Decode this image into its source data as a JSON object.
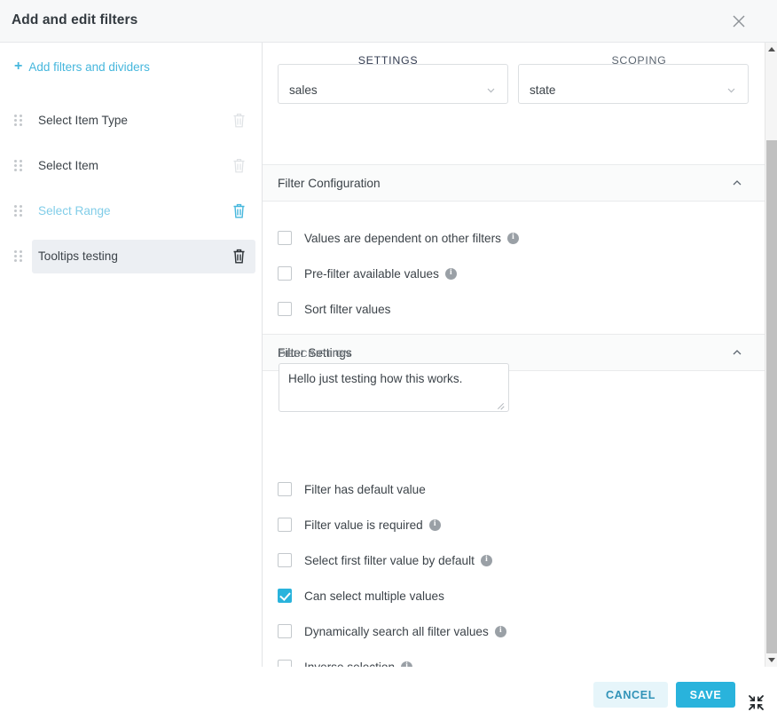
{
  "dialog": {
    "title": "Add and edit filters",
    "close_icon": "close-icon"
  },
  "sidebar": {
    "add_label": "Add filters and dividers",
    "add_icon": "plus-icon",
    "items": [
      {
        "label": "Select Item Type",
        "state": "normal"
      },
      {
        "label": "Select Item",
        "state": "normal"
      },
      {
        "label": "Select Range",
        "state": "teal"
      },
      {
        "label": "Tooltips testing",
        "state": "selected"
      }
    ]
  },
  "tabs": [
    {
      "label": "SETTINGS",
      "active": true
    },
    {
      "label": "SCOPING",
      "active": false
    }
  ],
  "selects": [
    {
      "value": "sales",
      "icon": "chevron-down-icon"
    },
    {
      "value": "state",
      "icon": "chevron-down-icon"
    }
  ],
  "sections": {
    "filter_configuration": {
      "title": "Filter Configuration",
      "collapse_icon": "chevron-up-icon",
      "options": [
        {
          "label": "Values are dependent on other filters",
          "checked": false,
          "info": true
        },
        {
          "label": "Pre-filter available values",
          "checked": false,
          "info": true
        },
        {
          "label": "Sort filter values",
          "checked": false,
          "info": false
        }
      ]
    },
    "filter_settings": {
      "title": "Filter Settings",
      "collapse_icon": "chevron-up-icon",
      "description_label": "DESCRIPTION",
      "description_value": "Hello just testing how this works.",
      "description_placeholder": "",
      "options": [
        {
          "label": "Filter has default value",
          "checked": false,
          "info": false
        },
        {
          "label": "Filter value is required",
          "checked": false,
          "info": true
        },
        {
          "label": "Select first filter value by default",
          "checked": false,
          "info": true
        },
        {
          "label": "Can select multiple values",
          "checked": true,
          "info": false
        },
        {
          "label": "Dynamically search all filter values",
          "checked": false,
          "info": true
        },
        {
          "label": "Inverse selection",
          "checked": false,
          "info": true
        }
      ]
    }
  },
  "footer": {
    "cancel_label": "CANCEL",
    "save_label": "SAVE",
    "expand_icon": "collapse-arrows-icon"
  },
  "colors": {
    "accent": "#29b3dc",
    "tab_underline": "#3b4468",
    "link": "#46b7dd",
    "cancel_bg": "#e6f5fa"
  },
  "info_glyph": "i"
}
